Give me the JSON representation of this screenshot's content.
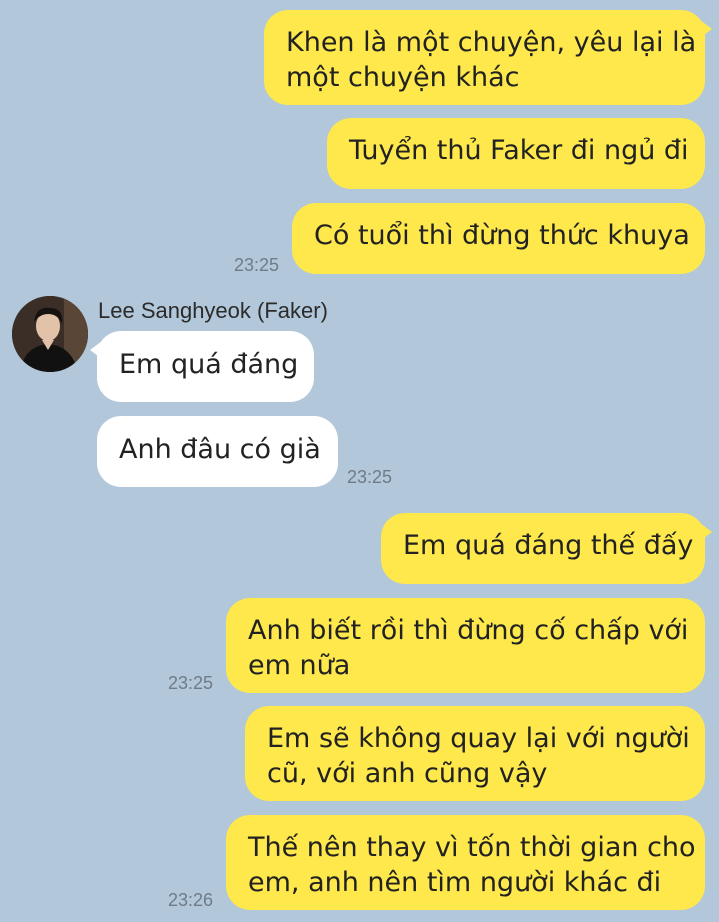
{
  "messages": {
    "m1": {
      "line1": "Khen là một chuyện, yêu lại là",
      "line2": "một chuyện khác"
    },
    "m2": {
      "line1": "Tuyển thủ Faker đi ngủ đi"
    },
    "m3": {
      "line1": "Có tuổi thì đừng thức khuya"
    },
    "f1": {
      "line1": "Em quá đáng"
    },
    "f2": {
      "line1": "Anh đâu có già"
    },
    "m4": {
      "line1": "Em quá đáng thế đấy"
    },
    "m5": {
      "line1": "Anh biết rồi thì đừng cố chấp với",
      "line2": "em nữa"
    },
    "m6": {
      "line1": "Em sẽ không quay lại với người",
      "line2": "cũ, với anh cũng vậy"
    },
    "m7": {
      "line1": "Thế nên thay vì tốn thời gian cho",
      "line2": "em, anh nên tìm người khác đi"
    }
  },
  "timestamps": {
    "t1": "23:25",
    "t2": "23:25",
    "t3": "23:25",
    "t4": "23:26"
  },
  "sender": {
    "name": "Lee Sanghyeok (Faker)",
    "avatar_icon": "profile-photo-icon"
  },
  "colors": {
    "background": "#b2c7d9",
    "my_bubble": "#fee84b",
    "friend_bubble": "#ffffff",
    "timestamp": "#6e7b88"
  }
}
